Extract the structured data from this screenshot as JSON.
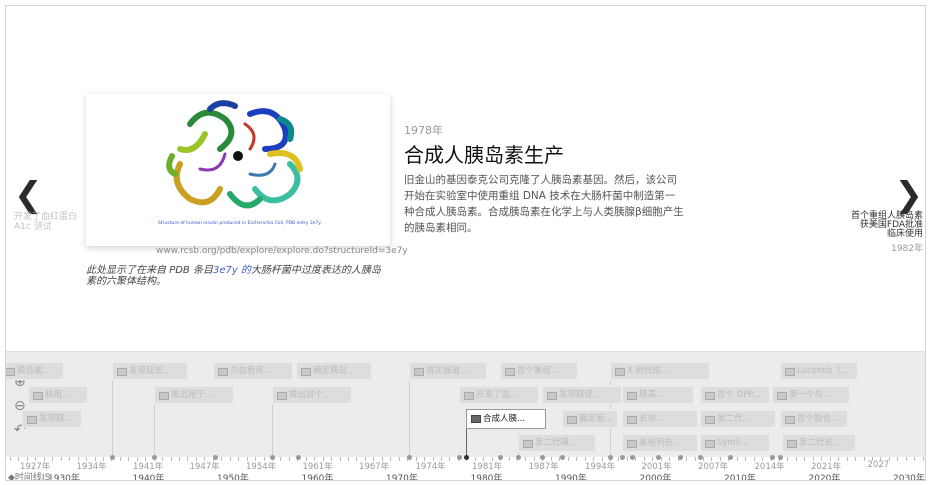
{
  "slide": {
    "date": "1978年",
    "headline": "合成人胰岛素生产",
    "body": "旧金山的基因泰克公司克隆了人胰岛素基因。然后，该公司开始在实验室中使用重组 DNA 技术在大肠杆菌中制造第一种合成人胰岛素。合成胰岛素在化学上与人类胰腺β细胞产生的胰岛素相同。",
    "media_credit": "www.rcsb.org/pdb/explore/explore.do?structureId=3e7y",
    "media_image_caption": "Structure of human insulin produced in Escherichia Coli, PDB entry 3e7y",
    "caption_pre": "此处显示了在来自 PDB 条目",
    "caption_link": "3e7y 的",
    "caption_post": "大肠杆菌中过度表达的人胰岛素的六聚体结构。"
  },
  "nav": {
    "prev_arrow": "❮",
    "prev_title": "开发了血红蛋白 A1c 测试",
    "next_arrow": "❯",
    "next_title": "首个重组人胰岛素获美国FDA批准临床使用",
    "next_date": "1982年"
  },
  "icons": {
    "prev": "chevron-left-icon",
    "next": "chevron-right-icon",
    "zoom_in": "zoom-in-icon",
    "zoom_out": "zoom-out-icon",
    "back": "back-icon",
    "image": "image-icon"
  },
  "timeline": {
    "zoom_in": "⊕",
    "zoom_out": "⊖",
    "back": "↶",
    "markers": [
      {
        "text": "胰岛素..."
      },
      {
        "text": "发现延长..."
      },
      {
        "text": "与血管疾..."
      },
      {
        "text": "确定胰岛..."
      },
      {
        "text": "首次报道..."
      },
      {
        "text": "首个重组..."
      },
      {
        "text": "Lucentis（..."
      },
      {
        "text": "胰用..."
      },
      {
        "text": "推出用于..."
      },
      {
        "text": "推出首个..."
      },
      {
        "text": "开发了血..."
      },
      {
        "text": "发现胰促..."
      },
      {
        "text": "首个 DPP..."
      },
      {
        "text": "第一个与..."
      },
      {
        "text": "发现胰..."
      },
      {
        "text": "合成人胰..."
      },
      {
        "text": "确定葡..."
      },
      {
        "text": "首个融合..."
      },
      {
        "text": "第二代磺..."
      },
      {
        "text": "美格列奈..."
      },
      {
        "text": "第二代长..."
      },
      {
        "text": "Symli..."
      },
      {
        "text": "X 射线结..."
      },
      {
        "text": "第二代..."
      },
      {
        "text": "长效..."
      },
      {
        "text": "胰高..."
      }
    ],
    "major_years": [
      "1930年",
      "1940年",
      "1950年",
      "1960年",
      "1970年",
      "1980年",
      "1990年",
      "2000年",
      "2010年",
      "2020年",
      "2030年"
    ],
    "minor_years": [
      "1927年",
      "1934年",
      "1941年",
      "1947年",
      "1954年",
      "1961年",
      "1967年",
      "1974年",
      "1981年",
      "1987年",
      "1994年",
      "2001年",
      "2007年",
      "2014年",
      "2021年",
      "2027"
    ],
    "brand": "◆时间线JS"
  }
}
